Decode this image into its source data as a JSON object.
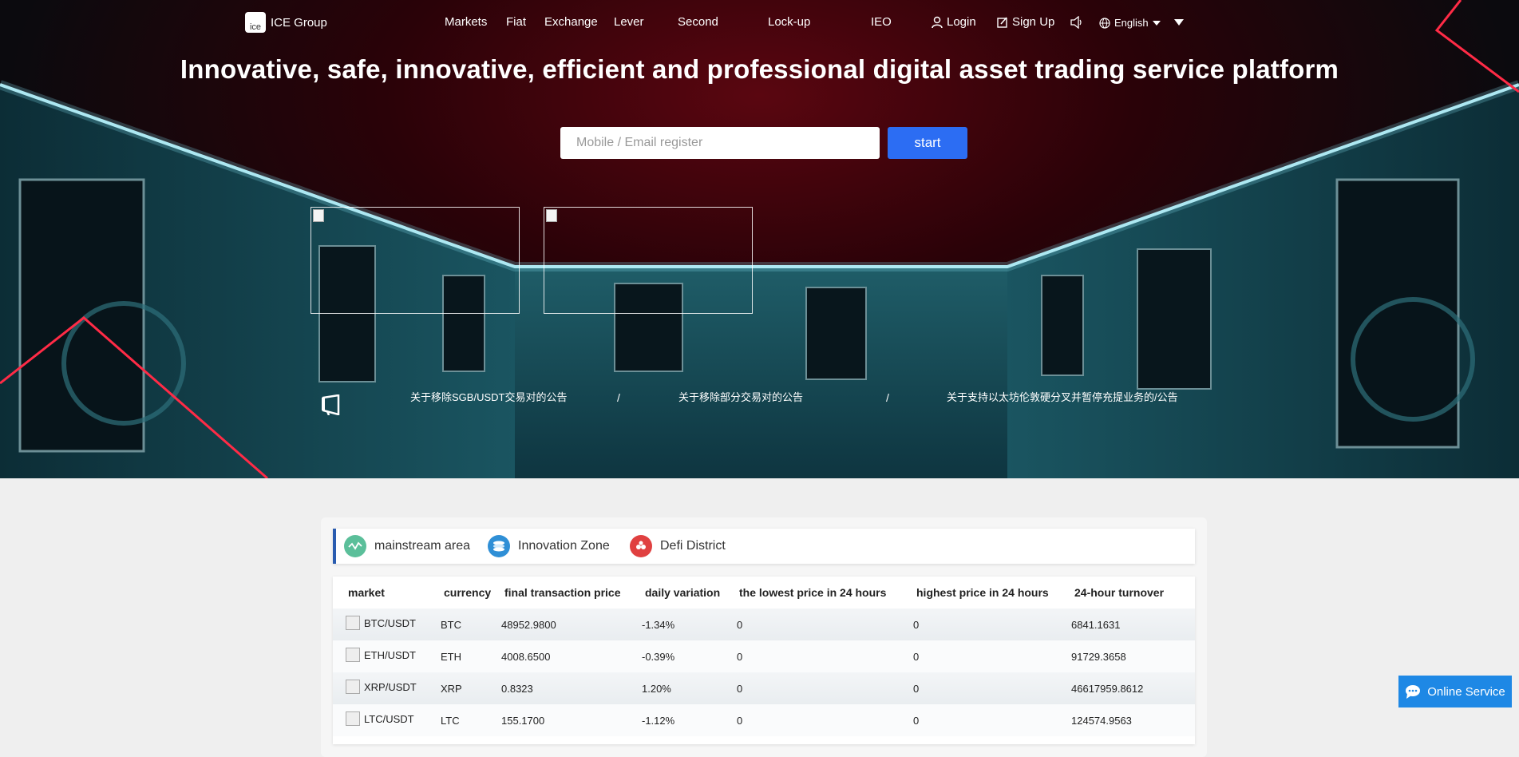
{
  "header": {
    "brand": "ICE Group",
    "brand_logo_text": "ice",
    "nav": [
      "Markets",
      "Fiat",
      "Exchange",
      "Lever",
      "Second",
      "Lock-up",
      "IEO"
    ],
    "login": "Login",
    "signup": "Sign Up",
    "language": "English"
  },
  "hero": {
    "title": "Innovative, safe, innovative, efficient and professional digital asset trading service platform",
    "register_placeholder": "Mobile / Email register",
    "start_label": "start"
  },
  "notices": [
    "关于移除SGB/USDT交易对的公告",
    "关于移除部分交易对的公告",
    "关于支持以太坊伦敦硬分叉并暂停充提业务的/公告"
  ],
  "notice_separator": "/",
  "market": {
    "tabs": [
      "mainstream area",
      "Innovation Zone",
      "Defi District"
    ],
    "columns": [
      "market",
      "currency",
      "final transaction price",
      "daily variation",
      "the lowest price in 24 hours",
      "highest price in 24 hours",
      "24-hour turnover"
    ],
    "rows": [
      {
        "market": "BTC/USDT",
        "currency": "BTC",
        "price": "48952.9800",
        "change": "-1.34%",
        "low": "0",
        "high": "0",
        "turnover": "6841.1631"
      },
      {
        "market": "ETH/USDT",
        "currency": "ETH",
        "price": "4008.6500",
        "change": "-0.39%",
        "low": "0",
        "high": "0",
        "turnover": "91729.3658"
      },
      {
        "market": "XRP/USDT",
        "currency": "XRP",
        "price": "0.8323",
        "change": "1.20%",
        "low": "0",
        "high": "0",
        "turnover": "46617959.8612"
      },
      {
        "market": "LTC/USDT",
        "currency": "LTC",
        "price": "155.1700",
        "change": "-1.12%",
        "low": "0",
        "high": "0",
        "turnover": "124574.9563"
      }
    ]
  },
  "support": {
    "label": "Online Service"
  },
  "colors": {
    "accent": "#2c6df3",
    "support": "#1e88e5",
    "tab_marker": "#2a5cb0"
  }
}
